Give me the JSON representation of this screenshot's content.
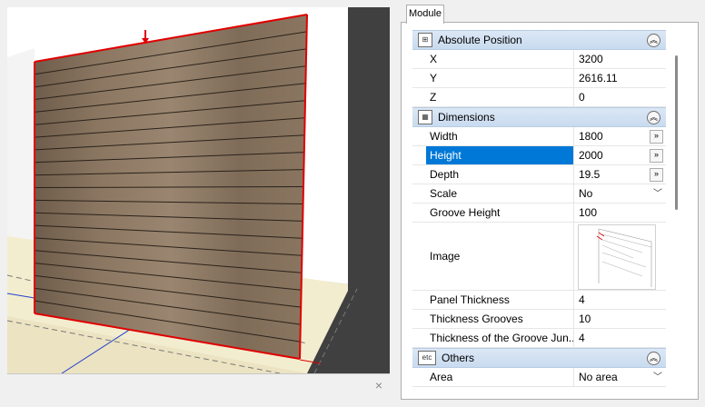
{
  "tab": {
    "label": "Module"
  },
  "viewport": {
    "close_label": "×"
  },
  "sections": {
    "absolute_position": {
      "title": "Absolute Position",
      "icon": "position-icon",
      "rows": [
        {
          "name": "X",
          "value": "3200"
        },
        {
          "name": "Y",
          "value": "2616.11"
        },
        {
          "name": "Z",
          "value": "0"
        }
      ]
    },
    "dimensions": {
      "title": "Dimensions",
      "icon": "dimensions-icon",
      "rows": [
        {
          "name": "Width",
          "value": "1800"
        },
        {
          "name": "Height",
          "value": "2000"
        },
        {
          "name": "Depth",
          "value": "19.5"
        },
        {
          "name": "Scale",
          "value": "No"
        },
        {
          "name": "Groove Height",
          "value": "100"
        },
        {
          "name": "Image",
          "value": ""
        },
        {
          "name": "Panel Thickness",
          "value": "4"
        },
        {
          "name": "Thickness Grooves",
          "value": "10"
        },
        {
          "name": "Thickness of the Groove Jun...",
          "value": "4"
        }
      ]
    },
    "others": {
      "title": "Others",
      "icon_text": "etc",
      "rows": [
        {
          "name": "Area",
          "value": "No area"
        }
      ]
    }
  },
  "colors": {
    "selection": "#0078d7",
    "category_header": "#d3e2f4",
    "wood": "#8a7560"
  }
}
